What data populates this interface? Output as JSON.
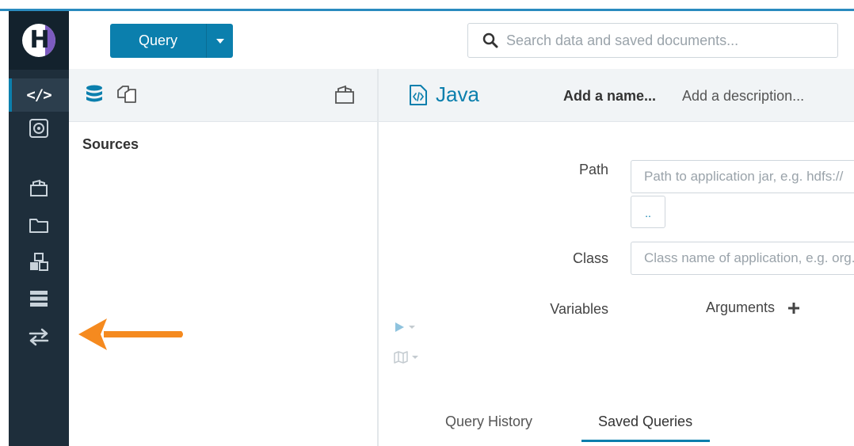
{
  "top_bar": {
    "query_button_label": "Query",
    "search_placeholder": "Search data and saved documents..."
  },
  "sidebar_rail": {
    "logo": "H",
    "items": [
      {
        "icon": "code-icon",
        "label": "</>",
        "active": true
      },
      {
        "icon": "circle-dot-icon",
        "active": false
      },
      {
        "icon": "open-folder-icon",
        "active": false
      },
      {
        "icon": "folder-icon",
        "active": false
      },
      {
        "icon": "cubes-icon",
        "active": false
      },
      {
        "icon": "server-icon",
        "active": false
      },
      {
        "icon": "exchange-arrows-icon",
        "active": false
      }
    ]
  },
  "left_panel": {
    "icons": [
      "database-icon",
      "copy-icon",
      "folder-open-icon"
    ],
    "sources_label": "Sources"
  },
  "editor_header": {
    "icon": "java-file-icon",
    "title": "Java",
    "name_placeholder": "Add a name...",
    "description_placeholder": "Add a description..."
  },
  "form": {
    "path_label": "Path",
    "path_placeholder": "Path to application jar, e.g. hdfs://",
    "browse_button": "..",
    "class_label": "Class",
    "class_placeholder": "Class name of application, e.g. org.apache",
    "variables_label": "Variables",
    "arguments_label": "Arguments",
    "add_icon": "plus-icon"
  },
  "bottom_tabs": [
    {
      "label": "Query History",
      "active": false
    },
    {
      "label": "Saved Queries",
      "active": true
    }
  ],
  "colors": {
    "accent": "#0b7fad",
    "rail_background": "#1e2e3b",
    "annotation_arrow": "#f58a1f",
    "logo_purple": "#7c5bc0"
  }
}
